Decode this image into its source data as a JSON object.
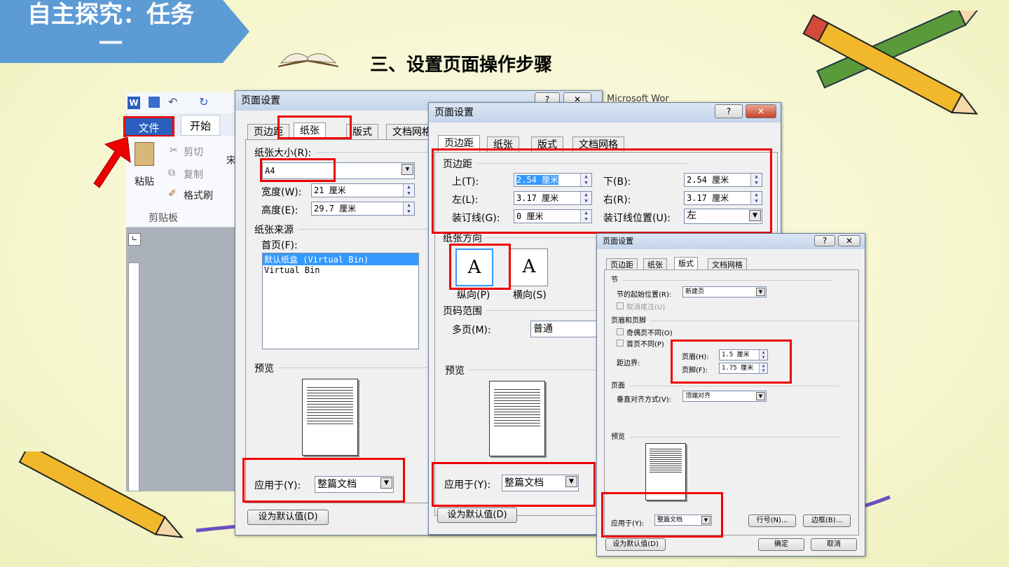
{
  "slide": {
    "banner_line1": "自主探究：任务",
    "banner_line2": "一",
    "subtitle": "三、设置页面操作步骤"
  },
  "word": {
    "file_tab": "文件",
    "home_tab": "开始",
    "cut": "剪切",
    "copy": "复制",
    "paste": "粘贴",
    "format_painter": "格式刷",
    "clipboard": "剪贴板",
    "font_char": "宋",
    "bg_title": "Microsoft Wor"
  },
  "dialog1": {
    "title": "页面设置",
    "tabs": [
      "页边距",
      "纸张",
      "版式",
      "文档网格"
    ],
    "paper_size_label": "纸张大小(R):",
    "paper_size_value": "A4",
    "width_label": "宽度(W):",
    "width_value": "21 厘米",
    "height_label": "高度(E):",
    "height_value": "29.7 厘米",
    "paper_source": "纸张来源",
    "first_page": "首页(F):",
    "bins": [
      "默认纸盒 (Virtual Bin)",
      "Virtual Bin"
    ],
    "preview": "预览",
    "apply_label": "应用于(Y):",
    "apply_value": "整篇文档",
    "default_btn": "设为默认值(D)"
  },
  "dialog2": {
    "title": "页面设置",
    "tabs": [
      "页边距",
      "纸张",
      "版式",
      "文档网格"
    ],
    "margins": "页边距",
    "top_label": "上(T):",
    "top_value": "2.54 厘米",
    "bottom_label": "下(B):",
    "bottom_value": "2.54 厘米",
    "left_label": "左(L):",
    "left_value": "3.17 厘米",
    "right_label": "右(R):",
    "right_value": "3.17 厘米",
    "gutter_label": "装订线(G):",
    "gutter_value": "0 厘米",
    "gutter_pos_label": "装订线位置(U):",
    "gutter_pos_value": "左",
    "orientation": "纸张方向",
    "portrait": "纵向(P)",
    "landscape": "横向(S)",
    "pages": "页码范围",
    "multi_label": "多页(M):",
    "multi_value": "普通",
    "preview": "预览",
    "apply_label": "应用于(Y):",
    "apply_value": "整篇文档",
    "default_btn": "设为默认值(D)"
  },
  "dialog3": {
    "title": "页面设置",
    "tabs": [
      "页边距",
      "纸张",
      "版式",
      "文档网格"
    ],
    "section": "节",
    "section_start_label": "节的起始位置(R):",
    "section_start_value": "新建页",
    "suppress_endnotes": "取消尾注(U)",
    "headers_footers": "页眉和页脚",
    "odd_even": "奇偶页不同(O)",
    "first_diff": "首页不同(P)",
    "from_edge": "距边界:",
    "header_label": "页眉(H):",
    "header_value": "1.5 厘米",
    "footer_label": "页脚(F):",
    "footer_value": "1.75 厘米",
    "page": "页面",
    "valign_label": "垂直对齐方式(V):",
    "valign_value": "顶端对齐",
    "preview": "预览",
    "apply_label": "应用于(Y):",
    "apply_value": "整篇文档",
    "line_numbers": "行号(N)...",
    "borders": "边框(B)...",
    "default_btn": "设为默认值(D)",
    "ok": "确定",
    "cancel": "取消"
  },
  "icons": [
    "book-icon",
    "pencil-icon",
    "help-icon",
    "close-icon",
    "word-icon",
    "save-icon",
    "undo-icon",
    "redo-icon",
    "scissors-icon",
    "copy-icon",
    "brush-icon",
    "paste-icon",
    "red-arrow-icon"
  ],
  "colors": {
    "banner": "#5d9bd5",
    "highlight": "#e00000",
    "file_tab": "#2a5fbf"
  }
}
